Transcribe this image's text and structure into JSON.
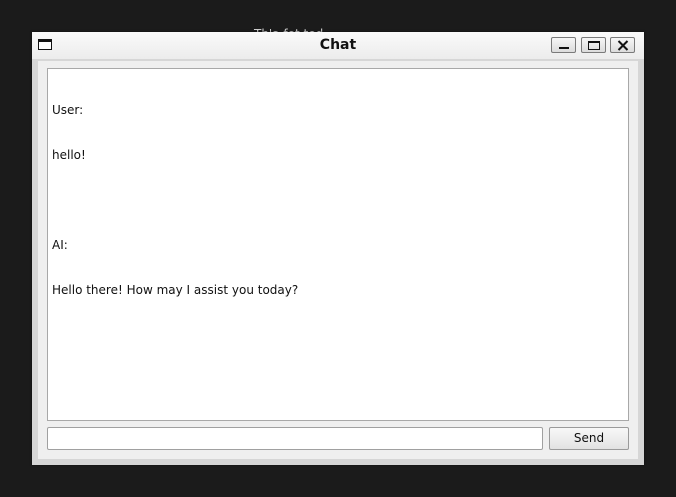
{
  "background_window": {
    "title_fragment": "Th'a fet ted"
  },
  "window": {
    "title": "Chat",
    "icons": {
      "app": "window-icon",
      "minimize": "minimize-icon",
      "maximize": "maximize-icon",
      "close": "close-icon"
    }
  },
  "chat": {
    "messages": [
      {
        "speaker": "User:",
        "text": "hello!"
      },
      {
        "speaker": "AI:",
        "text": "Hello there! How may I assist you today?"
      }
    ]
  },
  "input": {
    "value": "",
    "placeholder": ""
  },
  "send_button": {
    "label": "Send"
  }
}
